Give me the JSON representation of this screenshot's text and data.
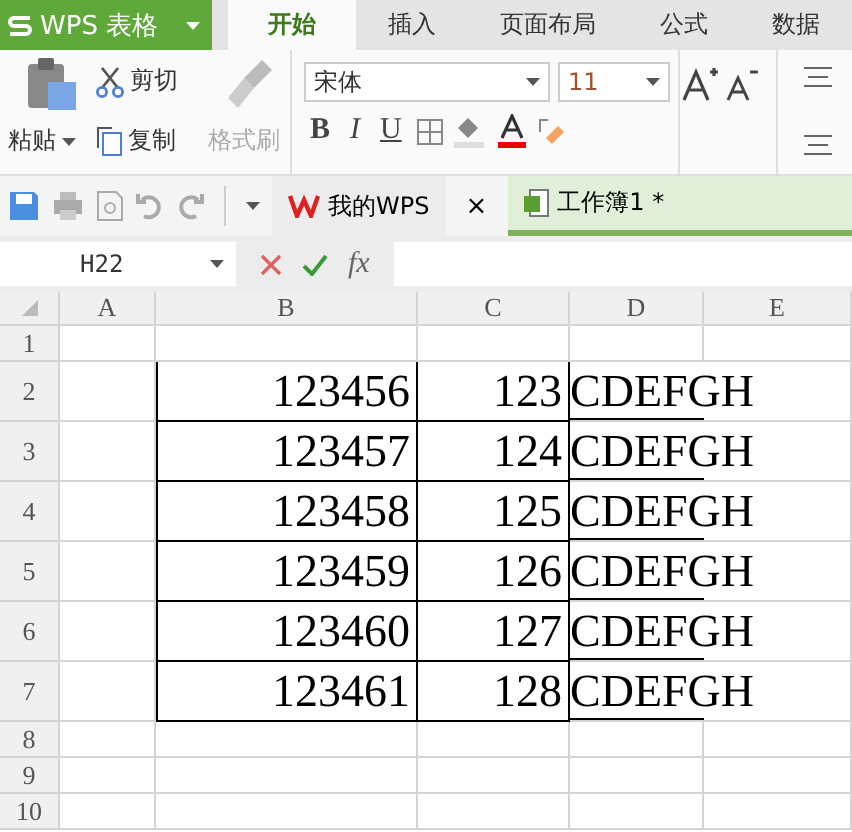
{
  "app_button": {
    "label": "WPS 表格"
  },
  "ribbon_tabs": [
    {
      "label": "开始",
      "selected": true
    },
    {
      "label": "插入",
      "selected": false
    },
    {
      "label": "页面布局",
      "selected": false
    },
    {
      "label": "公式",
      "selected": false
    },
    {
      "label": "数据",
      "selected": false
    }
  ],
  "clipboard": {
    "paste": "粘贴",
    "cut": "剪切",
    "copy": "复制",
    "format_painter": {
      "label": "格式刷",
      "disabled": true
    }
  },
  "font": {
    "name": "宋体",
    "size": "11",
    "bold": "B",
    "italic": "I",
    "underline": "U"
  },
  "doc_tabs": [
    {
      "kind": "home",
      "label": "我的WPS",
      "selected": false,
      "close": "×"
    },
    {
      "kind": "workbook",
      "label": "工作簿1 *",
      "selected": true
    }
  ],
  "formula_bar": {
    "name_box": "H22",
    "fx": "fx"
  },
  "columns": [
    "A",
    "B",
    "C",
    "D",
    "E"
  ],
  "rows": [
    {
      "number": "1"
    },
    {
      "number": "2",
      "b": "123456",
      "c": "123",
      "d": "CDEFGH"
    },
    {
      "number": "3",
      "b": "123457",
      "c": "124",
      "d": "CDEFGH"
    },
    {
      "number": "4",
      "b": "123458",
      "c": "125",
      "d": "CDEFGH"
    },
    {
      "number": "5",
      "b": "123459",
      "c": "126",
      "d": "CDEFGH"
    },
    {
      "number": "6",
      "b": "123460",
      "c": "127",
      "d": "CDEFGH"
    },
    {
      "number": "7",
      "b": "123461",
      "c": "128",
      "d": "CDEFGH"
    },
    {
      "number": "8"
    },
    {
      "number": "9"
    },
    {
      "number": "10"
    }
  ]
}
